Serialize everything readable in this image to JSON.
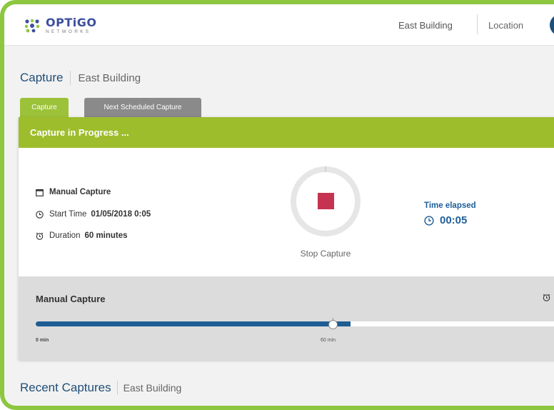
{
  "brand": {
    "name": "OPTiGO",
    "tagline": "NETWORKS"
  },
  "header": {
    "building": "East Building",
    "location": "Location"
  },
  "page": {
    "title": "Capture",
    "subtitle": "East Building"
  },
  "tabs": [
    {
      "label": "Capture",
      "active": true
    },
    {
      "label": "Next Scheduled Capture",
      "active": false
    }
  ],
  "capture": {
    "banner": "Capture in Progress ...",
    "type_label": "Manual Capture",
    "start_label": "Start Time",
    "start_value": "01/05/2018 0:05",
    "duration_label": "Duration",
    "duration_value": "60 minutes",
    "stop_label": "Stop Capture",
    "elapsed_label": "Time elapsed",
    "elapsed_value": "00:05"
  },
  "progress": {
    "title": "Manual Capture",
    "start_tick": "0 min",
    "mid_tick": "60 min",
    "fraction": 0.58
  },
  "recent": {
    "title": "Recent Captures",
    "subtitle": "East Building"
  },
  "colors": {
    "brand_green": "#9ebd2c",
    "tab_gray": "#8a8a8a",
    "accent_blue": "#1f5f99",
    "stop_red": "#c63350"
  },
  "icons": {
    "logo": "optigo-logo-icon",
    "calendar": "calendar-icon",
    "clock": "clock-icon",
    "alarm": "alarm-clock-icon",
    "stop": "stop-icon"
  }
}
